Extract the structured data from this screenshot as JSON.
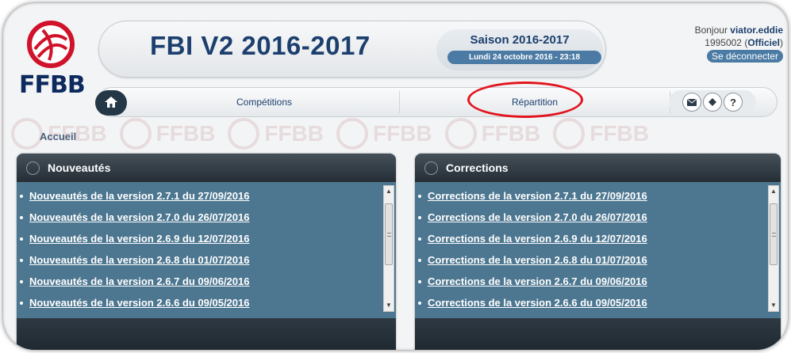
{
  "brand": {
    "logo_text": "FFBB",
    "accent": "#d0122a",
    "navy": "#1c3f6e"
  },
  "header": {
    "app_title": "FBI V2 2016-2017",
    "season_label": "Saison 2016-2017",
    "datetime": "Lundi 24 octobre 2016 - 23:18"
  },
  "user": {
    "greeting": "Bonjour",
    "username": "viator.eddie",
    "id_prefix": "1995002 (",
    "role": "Officiel",
    "id_suffix": ")",
    "logout_label": "Se déconnecter"
  },
  "nav": {
    "items": [
      {
        "label": "Compétitions"
      },
      {
        "label": "Répartition",
        "highlighted": true
      }
    ],
    "icons": [
      "home-icon",
      "mail-icon",
      "book-icon",
      "help-icon"
    ],
    "help_glyph": "?"
  },
  "breadcrumb": "Accueil",
  "panels": {
    "news": {
      "title": "Nouveautés",
      "items": [
        "Nouveautés de la version 2.7.1 du 27/09/2016",
        "Nouveautés de la version 2.7.0 du 26/07/2016",
        "Nouveautés de la version 2.6.9 du 12/07/2016",
        "Nouveautés de la version 2.6.8 du 01/07/2016",
        "Nouveautés de la version 2.6.7 du 09/06/2016",
        "Nouveautés de la version 2.6.6 du 09/05/2016"
      ]
    },
    "corrections": {
      "title": "Corrections",
      "items": [
        "Corrections de la version 2.7.1 du 27/09/2016",
        "Corrections de la version 2.7.0 du 26/07/2016",
        "Corrections de la version 2.6.9 du 12/07/2016",
        "Corrections de la version 2.6.8 du 01/07/2016",
        "Corrections de la version 2.6.7 du 09/06/2016",
        "Corrections de la version 2.6.6 du 09/05/2016"
      ]
    }
  },
  "watermark_text": "FFBB"
}
